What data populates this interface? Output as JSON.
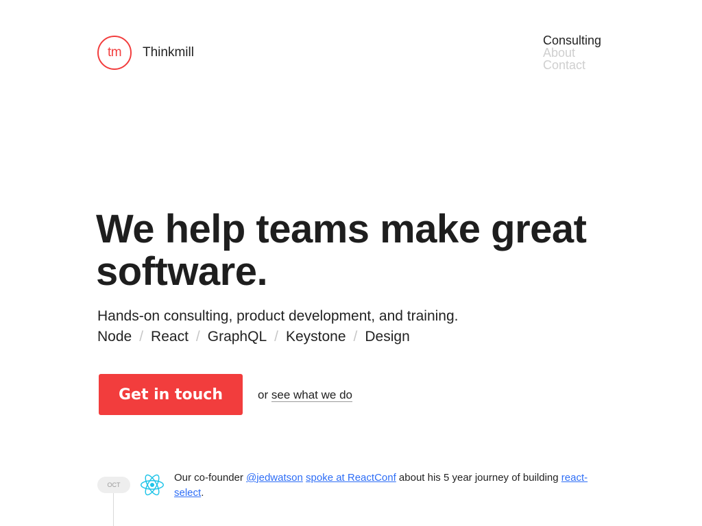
{
  "brand": {
    "logo_mark": "tm",
    "name": "Thinkmill",
    "accent": "#f23d3d"
  },
  "nav": {
    "items": [
      {
        "label": "Consulting",
        "active": true
      },
      {
        "label": "About",
        "active": false
      },
      {
        "label": "Contact",
        "active": false
      }
    ]
  },
  "hero": {
    "title": "We help teams make great software.",
    "subtitle": "Hands-on consulting, product development, and training.",
    "tags": [
      "Node",
      "React",
      "GraphQL",
      "Keystone",
      "Design"
    ],
    "separator": "/",
    "cta_label": "Get in touch",
    "alt_prefix": "or",
    "alt_link": "see what we do"
  },
  "news": {
    "items": [
      {
        "month": "OCT",
        "icon": "react-icon",
        "text_1": "Our co-founder ",
        "link_1": "@jedwatson",
        "text_2": " ",
        "link_2": "spoke at ReactConf",
        "text_3": " about his 5 year journey of building ",
        "link_3": "react-select",
        "text_4": "."
      }
    ]
  },
  "colors": {
    "link": "#2d6df6",
    "text": "#222222",
    "muted": "#cfcfcf"
  }
}
